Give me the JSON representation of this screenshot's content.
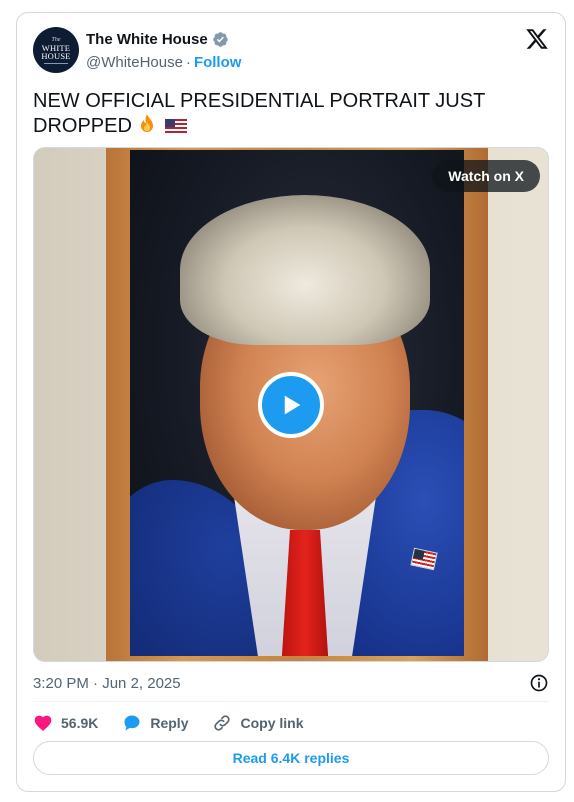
{
  "author": {
    "name": "The White House",
    "handle": "@WhiteHouse",
    "separator": "·",
    "follow_label": "Follow",
    "avatar_text": {
      "small": "The",
      "line1": "WHITE",
      "line2": "HOUSE"
    },
    "verified_icon": "verified-badge-icon",
    "verified_color": "#829aab"
  },
  "platform_icon": "x-logo-icon",
  "tweet": {
    "text": "NEW OFFICIAL PRESIDENTIAL PORTRAIT JUST DROPPED",
    "emojis": [
      "fire-emoji",
      "us-flag-emoji"
    ]
  },
  "media": {
    "type": "video",
    "watch_label": "Watch on X",
    "play_icon": "play-icon"
  },
  "meta": {
    "time": "3:20 PM",
    "separator": "·",
    "date": "Jun 2, 2025",
    "info_icon": "info-icon"
  },
  "actions": {
    "likes_count": "56.9K",
    "reply_label": "Reply",
    "copy_link_label": "Copy link"
  },
  "replies_button_label": "Read 6.4K replies",
  "colors": {
    "accent": "#1d9bf0",
    "like": "#f91880",
    "muted_text": "#536471",
    "border": "#cfd9de"
  }
}
